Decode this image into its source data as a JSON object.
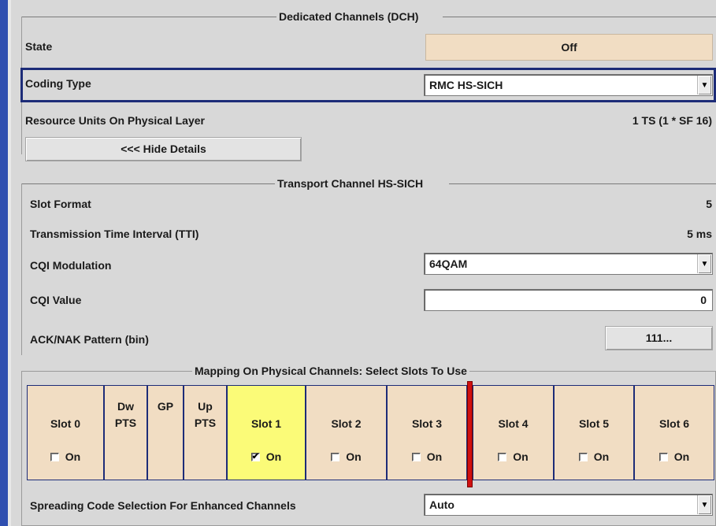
{
  "dch": {
    "title": "Dedicated Channels (DCH)",
    "state_label": "State",
    "state_value": "Off",
    "coding_type_label": "Coding Type",
    "coding_type_value": "RMC HS-SICH",
    "resource_units_label": "Resource Units On Physical Layer",
    "resource_units_value": "1 TS (1 * SF 16)",
    "hide_details_label": "<<< Hide Details"
  },
  "transport": {
    "title": "Transport Channel HS-SICH",
    "slot_format_label": "Slot Format",
    "slot_format_value": "5",
    "tti_label": "Transmission Time Interval (TTI)",
    "tti_value": "5 ms",
    "cqi_mod_label": "CQI Modulation",
    "cqi_mod_value": "64QAM",
    "cqi_value_label": "CQI Value",
    "cqi_value_value": "0",
    "acknak_label": "ACK/NAK Pattern (bin)",
    "acknak_value": "111..."
  },
  "mapping": {
    "title": "Mapping On Physical Channels: Select Slots To Use",
    "on_label": "On",
    "slots": [
      {
        "name": "Slot 0",
        "checked": false
      },
      {
        "name": "Dw PTS"
      },
      {
        "name": "GP"
      },
      {
        "name": "Up PTS"
      },
      {
        "name": "Slot 1",
        "checked": true
      },
      {
        "name": "Slot 2",
        "checked": false
      },
      {
        "name": "Slot 3",
        "checked": false
      },
      {
        "name": "Slot 4",
        "checked": false
      },
      {
        "name": "Slot 5",
        "checked": false
      },
      {
        "name": "Slot 6",
        "checked": false
      }
    ],
    "special": {
      "dw_line1": "Dw",
      "dw_line2": "PTS",
      "gp": "GP",
      "up_line1": "Up",
      "up_line2": "PTS"
    },
    "spreading_label": "Spreading Code Selection For Enhanced Channels",
    "spreading_value": "Auto"
  },
  "colors": {
    "accent_border": "#1d2c78",
    "switch_point": "#d01010",
    "selected_slot": "#fbfb78",
    "slot_bg": "#f1ddc3"
  },
  "icons": {
    "dropdown": "chevron-down-icon",
    "checkbox": "checkbox-icon"
  }
}
